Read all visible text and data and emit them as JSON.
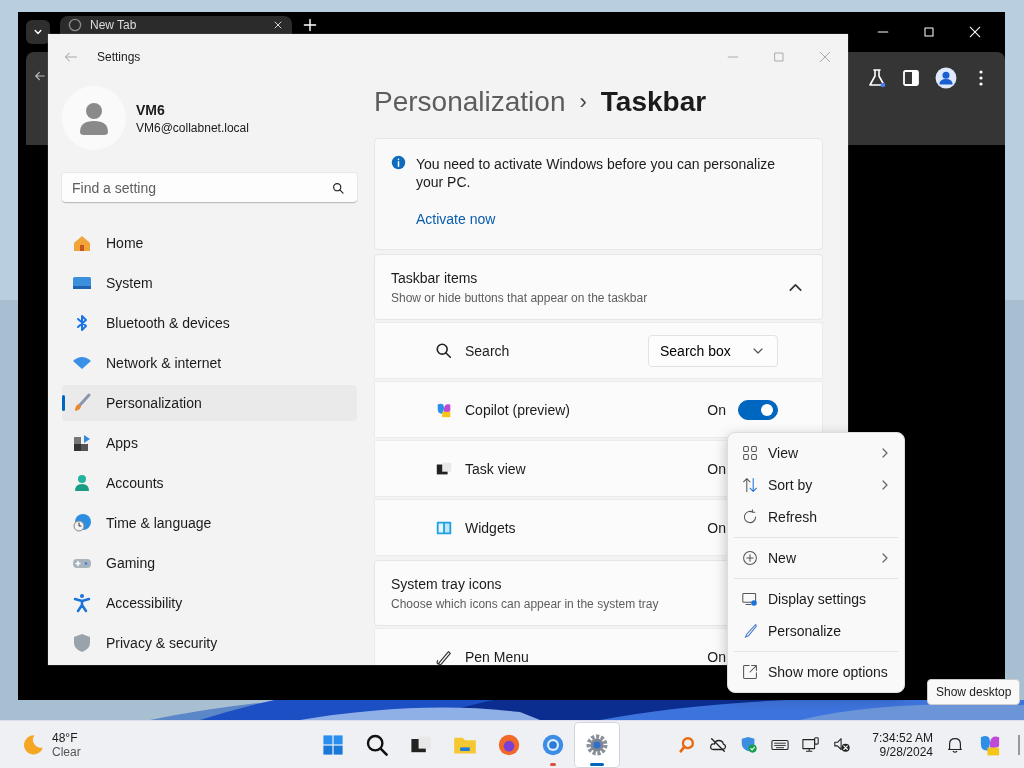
{
  "browser": {
    "tab": {
      "title": "New Tab"
    }
  },
  "settings": {
    "title": "Settings",
    "user": {
      "name": "VM6",
      "email": "VM6@collabnet.local"
    },
    "search": {
      "placeholder": "Find a setting"
    },
    "nav": [
      {
        "label": "Home",
        "selected": false
      },
      {
        "label": "System",
        "selected": false
      },
      {
        "label": "Bluetooth & devices",
        "selected": false
      },
      {
        "label": "Network & internet",
        "selected": false
      },
      {
        "label": "Personalization",
        "selected": true
      },
      {
        "label": "Apps",
        "selected": false
      },
      {
        "label": "Accounts",
        "selected": false
      },
      {
        "label": "Time & language",
        "selected": false
      },
      {
        "label": "Gaming",
        "selected": false
      },
      {
        "label": "Accessibility",
        "selected": false
      },
      {
        "label": "Privacy & security",
        "selected": false
      }
    ],
    "breadcrumb": {
      "parent": "Personalization",
      "separator": "›",
      "current": "Taskbar"
    },
    "banner": {
      "message": "You need to activate Windows before you can personalize your PC.",
      "link": "Activate now"
    },
    "sections": [
      {
        "title": "Taskbar items",
        "subtitle": "Show or hide buttons that appear on the taskbar",
        "expanded": true,
        "rows": [
          {
            "kind": "dropdown",
            "label": "Search",
            "value": "Search box"
          },
          {
            "kind": "toggle",
            "label": "Copilot (preview)",
            "status": "On",
            "on": true
          },
          {
            "kind": "toggle",
            "label": "Task view",
            "status": "On"
          },
          {
            "kind": "toggle",
            "label": "Widgets",
            "status": "On"
          }
        ]
      },
      {
        "title": "System tray icons",
        "subtitle": "Choose which icons can appear in the system tray",
        "rows": [
          {
            "kind": "toggle",
            "label": "Pen Menu",
            "status": "On"
          }
        ]
      }
    ]
  },
  "context_menu": {
    "items": [
      {
        "kind": "item",
        "label": "View",
        "submenu": true
      },
      {
        "kind": "item",
        "label": "Sort by",
        "submenu": true
      },
      {
        "kind": "item",
        "label": "Refresh",
        "submenu": false
      },
      {
        "kind": "separator"
      },
      {
        "kind": "item",
        "label": "New",
        "submenu": true
      },
      {
        "kind": "separator"
      },
      {
        "kind": "item",
        "label": "Display settings",
        "submenu": false
      },
      {
        "kind": "item",
        "label": "Personalize",
        "submenu": false
      },
      {
        "kind": "separator"
      },
      {
        "kind": "item",
        "label": "Show more options",
        "submenu": false
      }
    ]
  },
  "tooltip": {
    "text": "Show desktop"
  },
  "taskbar": {
    "weather": {
      "temperature": "48°F",
      "condition": "Clear"
    },
    "apps": [
      {
        "running": false,
        "active": false
      },
      {
        "running": false,
        "active": false
      },
      {
        "running": false,
        "active": false
      },
      {
        "running": false,
        "active": false
      },
      {
        "running": false,
        "active": false
      },
      {
        "running": true,
        "active": false
      },
      {
        "running": true,
        "active": true
      }
    ],
    "clock": {
      "time": "7:34:52 AM",
      "date": "9/28/2024"
    }
  }
}
